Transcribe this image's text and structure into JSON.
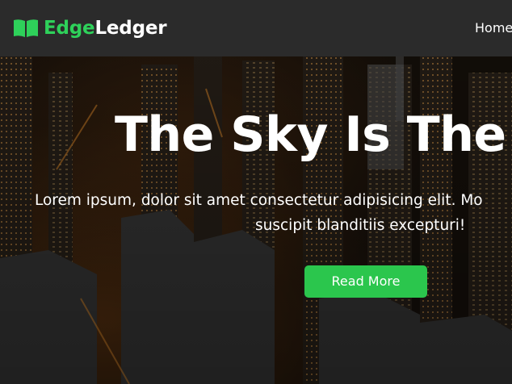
{
  "brand": {
    "name_part1": "Edge",
    "name_part2": "Ledger",
    "icon": "book-open-icon",
    "accent_color": "#2ed15a"
  },
  "nav": {
    "items": [
      {
        "label": "Home"
      }
    ]
  },
  "hero": {
    "title": "The Sky Is The L",
    "text_line1": "Lorem ipsum, dolor sit amet consectetur adipisicing elit. Mo",
    "text_line2": "suscipit blanditiis excepturi!",
    "button_label": "Read More",
    "button_color": "#2bc64d",
    "background": "city-skyline-night-photo"
  }
}
